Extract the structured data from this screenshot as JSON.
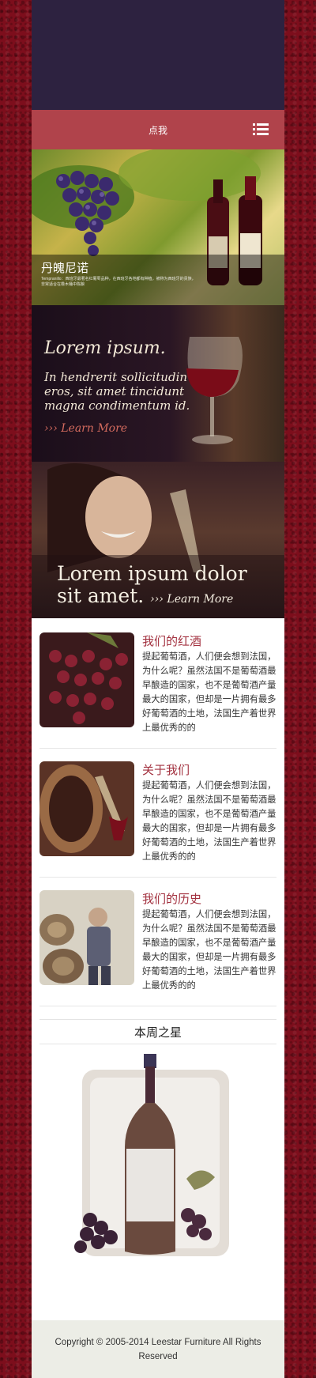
{
  "nav": {
    "menu_label": "点我"
  },
  "hero": {
    "title": "丹魄尼诺",
    "description": "Tempranillo：西班牙最著名红葡萄品种，在西班牙各地都有种植，被称为西班牙的贵族，非常适合在橡木桶中陈酿"
  },
  "banners": [
    {
      "title": "Lorem ipsum.",
      "text": "In hendrerit sollicitudin eros, sit amet tincidunt magna condimentum id.",
      "link": "››› Learn More"
    },
    {
      "text": "Lorem ipsum dolor sit amet.",
      "link": "››› Learn More"
    }
  ],
  "articles": [
    {
      "title": "我们的红酒",
      "body": "提起葡萄酒，人们便会想到法国，为什么呢？虽然法国不是葡萄酒最早酿造的国家，也不是葡萄酒产量最大的国家，但却是一片拥有最多好葡萄酒的土地，法国生产着世界上最优秀的的"
    },
    {
      "title": "关于我们",
      "body": "提起葡萄酒，人们便会想到法国，为什么呢？虽然法国不是葡萄酒最早酿造的国家，也不是葡萄酒产量最大的国家，但却是一片拥有最多好葡萄酒的土地，法国生产着世界上最优秀的的"
    },
    {
      "title": "我们的历史",
      "body": "提起葡萄酒，人们便会想到法国，为什么呢？虽然法国不是葡萄酒最早酿造的国家，也不是葡萄酒产量最大的国家，但却是一片拥有最多好葡萄酒的土地，法国生产着世界上最优秀的的"
    }
  ],
  "star": {
    "heading": "本周之星"
  },
  "footer": {
    "copyright": "Copyright © 2005-2014 Leestar Furniture All Rights Reserved"
  },
  "colors": {
    "accent": "#b0434b",
    "header_bg": "#2d2240",
    "title_red": "#a33240",
    "page_bg": "#7d0e1c"
  }
}
